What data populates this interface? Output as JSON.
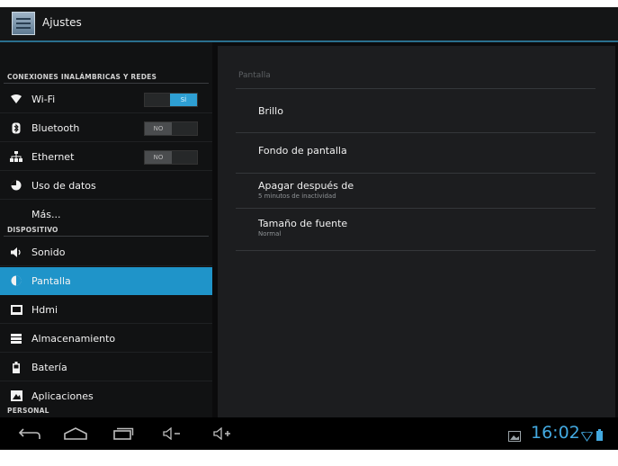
{
  "app": {
    "title": "Ajustes"
  },
  "sidebar": {
    "sections": {
      "wireless": "CONEXIONES INALÁMBRICAS Y REDES",
      "device": "DISPOSITIVO",
      "personal": "PERSONAL"
    },
    "wireless_items": [
      {
        "label": "Wi-Fi",
        "icon": "wifi-icon",
        "toggle": "SÍ",
        "toggle_state": "on"
      },
      {
        "label": "Bluetooth",
        "icon": "bluetooth-icon",
        "toggle": "NO",
        "toggle_state": "off"
      },
      {
        "label": "Ethernet",
        "icon": "ethernet-icon",
        "toggle": "NO",
        "toggle_state": "off"
      },
      {
        "label": "Uso de datos",
        "icon": "data-usage-icon"
      },
      {
        "label": "Más..."
      }
    ],
    "device_items": [
      {
        "label": "Sonido",
        "icon": "speaker-icon"
      },
      {
        "label": "Pantalla",
        "icon": "display-icon",
        "selected": true
      },
      {
        "label": "Hdmi",
        "icon": "hdmi-icon"
      },
      {
        "label": "Almacenamiento",
        "icon": "storage-icon"
      },
      {
        "label": "Batería",
        "icon": "battery-icon"
      },
      {
        "label": "Aplicaciones",
        "icon": "apps-icon"
      }
    ]
  },
  "detail": {
    "title": "Pantalla",
    "items": [
      {
        "title": "Brillo"
      },
      {
        "title": "Fondo de pantalla"
      },
      {
        "title": "Apagar después de",
        "summary": "5 minutos de inactividad"
      },
      {
        "title": "Tamaño de fuente",
        "summary": "Normal"
      }
    ]
  },
  "status": {
    "time": "16:02"
  },
  "colors": {
    "accent": "#1f94c9",
    "clock": "#43a9e0"
  }
}
